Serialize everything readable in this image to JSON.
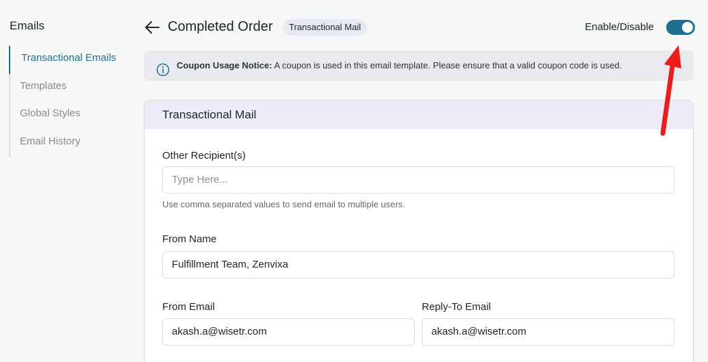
{
  "sidebar": {
    "title": "Emails",
    "items": [
      {
        "label": "Transactional Emails"
      },
      {
        "label": "Templates"
      },
      {
        "label": "Global Styles"
      },
      {
        "label": "Email History"
      }
    ]
  },
  "header": {
    "back_icon": "arrow-left-icon",
    "title": "Completed Order",
    "badge": "Transactional Mail",
    "toggle_label": "Enable/Disable",
    "toggle_on": true
  },
  "notice": {
    "icon": "info-icon",
    "title": "Coupon Usage Notice:",
    "text": "A coupon is used in this email template. Please ensure that a valid coupon code is used."
  },
  "card": {
    "title": "Transactional Mail",
    "other_recipients": {
      "label": "Other Recipient(s)",
      "placeholder": "Type Here...",
      "value": "",
      "help": "Use comma separated values to send email to multiple users."
    },
    "from_name": {
      "label": "From Name",
      "value": "Fulfillment Team, Zenvixa"
    },
    "from_email": {
      "label": "From Email",
      "value": "akash.a@wisetr.com"
    },
    "reply_to_email": {
      "label": "Reply-To Email",
      "value": "akash.a@wisetr.com"
    }
  },
  "colors": {
    "accent": "#1e6f92",
    "annotation_arrow": "#ee1c1c",
    "notice_bg": "#e8eaf0",
    "card_header_bg": "#ecedf8"
  }
}
